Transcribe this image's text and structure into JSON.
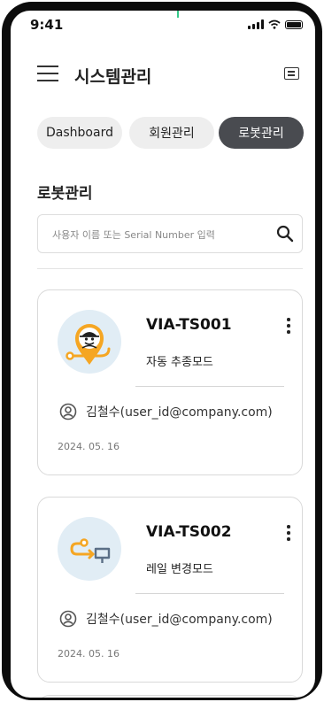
{
  "status_bar": {
    "time": "9:41"
  },
  "header": {
    "title": "시스템관리"
  },
  "tabs": [
    {
      "label": "Dashboard",
      "active": false
    },
    {
      "label": "회원관리",
      "active": false
    },
    {
      "label": "로봇관리",
      "active": true
    }
  ],
  "section": {
    "title": "로봇관리"
  },
  "search": {
    "placeholder": "사용자 이름 또는 Serial Number 입력",
    "value": ""
  },
  "robots": [
    {
      "name": "VIA-TS001",
      "mode": "자동 추종모드",
      "user": "김철수(user_id@company.com)",
      "date": "2024. 05. 16",
      "icon": "auto-follow-robot-icon"
    },
    {
      "name": "VIA-TS002",
      "mode": "레일 변경모드",
      "user": "김철수(user_id@company.com)",
      "date": "2024. 05. 16",
      "icon": "rail-change-icon"
    }
  ],
  "colors": {
    "accent_orange": "#f5a623",
    "active_tab": "#494b50",
    "avatar_bg": "#e1edf5"
  }
}
